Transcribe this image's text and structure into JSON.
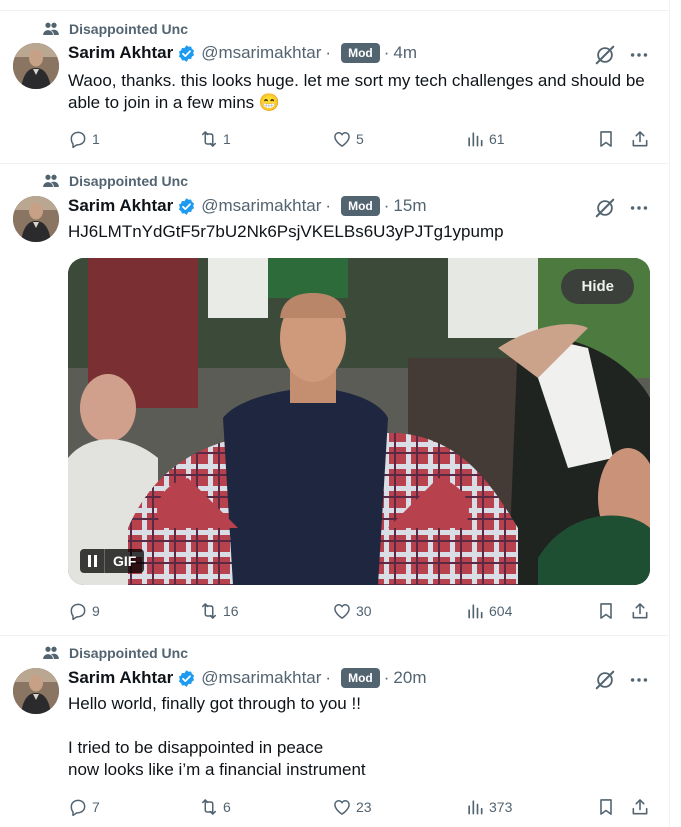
{
  "colors": {
    "text": "#0f1419",
    "secondary": "#536471",
    "verified": "#1d9bf0",
    "mod_badge": "#536471",
    "divider": "#eff3f4"
  },
  "icons": {
    "context": "community-icon",
    "verified": "verified-badge-icon",
    "grok": "grok-icon",
    "more": "more-icon",
    "reply": "reply-icon",
    "retweet": "retweet-icon",
    "like": "like-icon",
    "views": "views-icon",
    "bookmark": "bookmark-icon",
    "share": "share-icon"
  },
  "tweets": [
    {
      "context": "Disappointed Unc",
      "name": "Sarim Akhtar",
      "handle": "@msarimakhtar",
      "sep": "·",
      "badge": "Mod",
      "time": "4m",
      "text": "Waoo, thanks. this looks huge. let me sort my tech challenges and should be able to join in a few mins 😁",
      "replies": "1",
      "retweets": "1",
      "likes": "5",
      "views": "61"
    },
    {
      "context": "Disappointed Unc",
      "name": "Sarim Akhtar",
      "handle": "@msarimakhtar",
      "sep": "·",
      "badge": "Mod",
      "time": "15m",
      "text": "HJ6LMTnYdGtF5r7bU2Nk6PsjVKELBs6U3yPJTg1ypump",
      "media": {
        "hide_label": "Hide",
        "gif_label": "GIF"
      },
      "replies": "9",
      "retweets": "16",
      "likes": "30",
      "views": "604"
    },
    {
      "context": "Disappointed Unc",
      "name": "Sarim Akhtar",
      "handle": "@msarimakhtar",
      "sep": "·",
      "badge": "Mod",
      "time": "20m",
      "text": "Hello world, finally got through to you !!\n\nI tried to be disappointed in peace\nnow looks like i’m a financial instrument",
      "replies": "7",
      "retweets": "6",
      "likes": "23",
      "views": "373"
    }
  ]
}
